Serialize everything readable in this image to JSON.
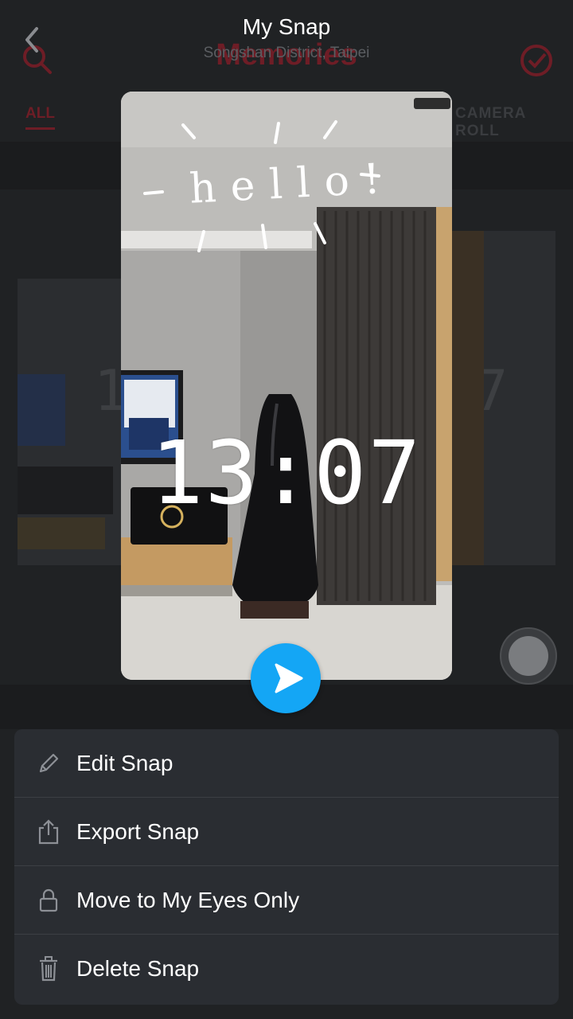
{
  "background": {
    "screen_title": "Memories",
    "tab_all": "ALL",
    "tab_camera_roll": "CAMERA ROLL",
    "thumb_clock_left": "13",
    "thumb_clock_right": "17"
  },
  "header": {
    "title": "My Snap",
    "location": "Songshan District, Taipei"
  },
  "snap": {
    "caption_drawing": "hello!",
    "time_sticker": "13:07"
  },
  "play_button": {
    "icon": "play-icon",
    "color": "#14a6f5"
  },
  "actions": [
    {
      "label": "Edit Snap",
      "icon": "pencil-icon"
    },
    {
      "label": "Export Snap",
      "icon": "share-icon"
    },
    {
      "label": "Move to My Eyes Only",
      "icon": "lock-icon"
    },
    {
      "label": "Delete Snap",
      "icon": "trash-icon"
    }
  ],
  "colors": {
    "accent_red": "#6e1d26",
    "play_blue": "#14a6f5",
    "sheet_bg": "#2a2d32"
  }
}
